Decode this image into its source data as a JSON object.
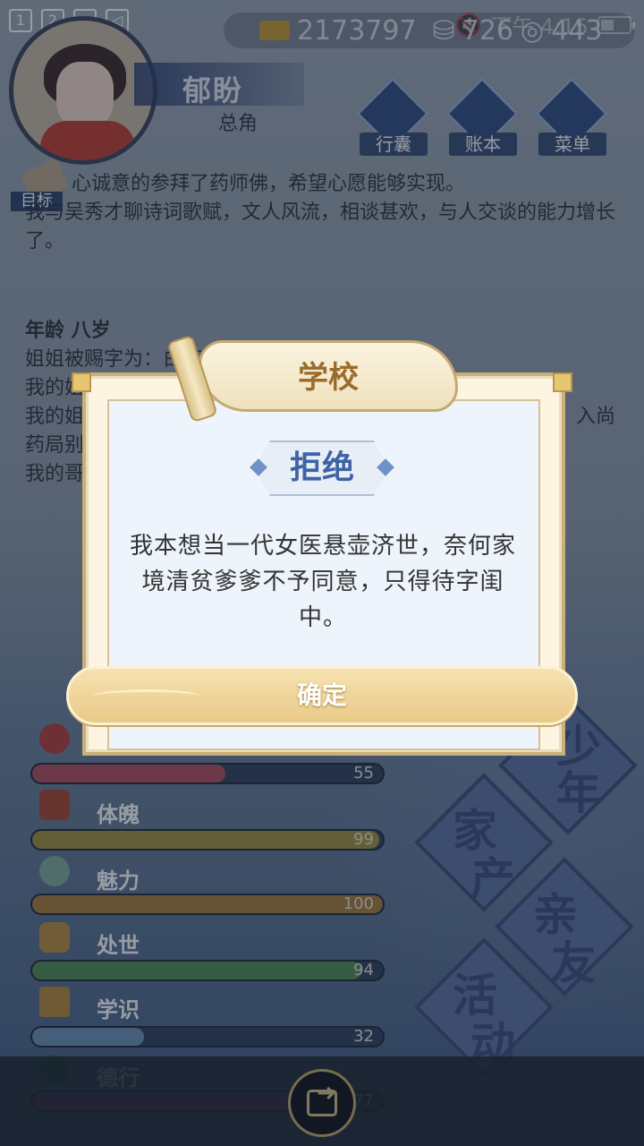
{
  "status_bar": {
    "notifications": [
      "1",
      "2"
    ],
    "time": "下午 4:15"
  },
  "currency": {
    "gold": "2173797",
    "silver": "726",
    "other": "443"
  },
  "header": {
    "name": "郁盼",
    "role": "总角",
    "goal_label": "目标",
    "buttons": {
      "bag": "行囊",
      "ledger": "账本",
      "menu": "菜单"
    }
  },
  "log": {
    "line1": "心诚意的参拜了药师佛，希望心愿能够实现。",
    "line2": "我与吴秀才聊诗词歌赋，文人风流，相谈甚欢，与人交谈的能力增长了。",
    "age_heading": "年龄 八岁",
    "line3": "姐姐被赐字为：白芷",
    "line4": "我的姐",
    "line5": "我的姐",
    "line5_tail": "入尚",
    "line6": "药局别",
    "line7": "我的哥"
  },
  "stats": [
    {
      "label": "",
      "value": "55",
      "fraction": 0.55,
      "color": "#b24a5a"
    },
    {
      "label": "体魄",
      "value": "99",
      "fraction": 0.99,
      "color": "#9e8f3c"
    },
    {
      "label": "魅力",
      "value": "100",
      "fraction": 1.0,
      "color": "#a67b3a"
    },
    {
      "label": "处世",
      "value": "94",
      "fraction": 0.94,
      "color": "#4f8a52"
    },
    {
      "label": "学识",
      "value": "32",
      "fraction": 0.32,
      "color": "#6b8fb5"
    },
    {
      "label": "德行",
      "value": "77",
      "fraction": 0.77,
      "color": "#7a4a8a"
    }
  ],
  "actions": {
    "youth": [
      "少",
      "年"
    ],
    "estate": [
      "家",
      "产"
    ],
    "friends": [
      "亲",
      "友"
    ],
    "activity": [
      "活",
      "动"
    ]
  },
  "modal": {
    "title": "学校",
    "result": "拒绝",
    "message": "我本想当一代女医悬壶济世，奈何家境清贫爹爹不予同意，只得待字闺中。",
    "confirm": "确定"
  }
}
